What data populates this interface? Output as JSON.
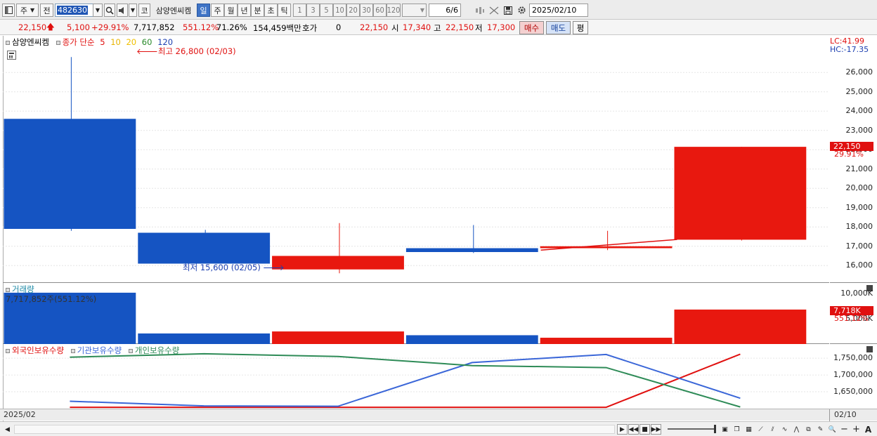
{
  "toolbar": {
    "market_type": "주",
    "prev_label": "전",
    "stock_code": "482630",
    "stock_name": "삼양엔씨켐",
    "periods": [
      "일",
      "주",
      "월",
      "년",
      "분",
      "초",
      "틱"
    ],
    "selected_period": "일",
    "intervals": [
      "1",
      "3",
      "5",
      "10",
      "20",
      "30",
      "60",
      "120"
    ],
    "page": "6/6",
    "date": "2025/02/10",
    "code_prefix": "코"
  },
  "quote": {
    "price": "22,150",
    "change": "5,100",
    "change_pct": "+29.91%",
    "volume": "7,717,852",
    "volume_ratio": "551.12%",
    "turnover_pct": "71.26%",
    "amount": "154,459백만",
    "hoga_label": "호가",
    "hoga_value": "0",
    "hoga_price": "22,150",
    "open_label": "시",
    "open": "17,340",
    "high_label": "고",
    "high": "22,150",
    "low_label": "저",
    "low": "17,300",
    "buy_label": "매수",
    "sell_label": "매도",
    "avg_label": "평"
  },
  "price_pane": {
    "stock_tag": "삼양엔씨켐",
    "legend_prefix": "종가 단순",
    "ma_labels": [
      {
        "label": "5",
        "color": "#e0100f"
      },
      {
        "label": "10",
        "color": "#e8b400"
      },
      {
        "label": "20",
        "color": "#f0c000"
      },
      {
        "label": "60",
        "color": "#2a8a2a"
      },
      {
        "label": "120",
        "color": "#1c3fb0"
      }
    ],
    "high_annotation": "최고 26,800 (02/03)",
    "low_annotation": "최저 15,600 (02/05)",
    "lc_label": "LC:41.99",
    "hc_label": "HC:-17.35",
    "current_price_tag": "22,150",
    "current_pct_tag": "29.91%"
  },
  "volume_pane": {
    "title": "거래량",
    "info": "7,717,852주(551.12%)",
    "current_tag": "7,718K",
    "current_pct_tag": "551.12%"
  },
  "holding_pane": {
    "legend": [
      {
        "label": "외국인보유수량",
        "color": "#e0100f"
      },
      {
        "label": "기관보유수량",
        "color": "#3a66d8"
      },
      {
        "label": "개인보유수량",
        "color": "#2e8b57"
      }
    ]
  },
  "x_axis": {
    "start_label": "2025/02",
    "end_label": "02/10"
  },
  "colors": {
    "up": "#e8180f",
    "down": "#1554c2",
    "bg": "#ffffff"
  },
  "chart_data": [
    {
      "type": "candlestick",
      "title": "",
      "y_ticks": [
        16000,
        17000,
        18000,
        19000,
        20000,
        21000,
        22000,
        23000,
        24000,
        25000,
        26000
      ],
      "y_tick_labels": [
        "16,000",
        "17,000",
        "18,000",
        "19,000",
        "20,000",
        "21,000",
        "22,000",
        "23,000",
        "24,000",
        "25,000",
        "26,000"
      ],
      "ylim": [
        15100,
        27900
      ],
      "candles": [
        {
          "open": 23600,
          "high": 26800,
          "low": 17800,
          "close": 17900
        },
        {
          "open": 17700,
          "high": 17850,
          "low": 16100,
          "close": 16100
        },
        {
          "open": 15800,
          "high": 18200,
          "low": 15600,
          "close": 16500
        },
        {
          "open": 16900,
          "high": 18100,
          "low": 16650,
          "close": 16700
        },
        {
          "open": 16900,
          "high": 17800,
          "low": 16800,
          "close": 17000
        },
        {
          "open": 17340,
          "high": 22150,
          "low": 17300,
          "close": 22150
        }
      ],
      "ma5": [
        null,
        null,
        null,
        null,
        16800,
        17350
      ]
    },
    {
      "type": "bar",
      "title": "",
      "y_ticks": [
        5000,
        10000
      ],
      "y_tick_labels": [
        "5,000K",
        "10,000K"
      ],
      "ylim": [
        0,
        12000
      ],
      "values": [
        10200,
        2100,
        2500,
        1750,
        1250,
        6850
      ],
      "directions": [
        "down",
        "down",
        "up",
        "down",
        "up",
        "up"
      ]
    },
    {
      "type": "line",
      "title": "",
      "y_ticks": [
        1650000,
        1700000,
        1750000
      ],
      "y_tick_labels": [
        "1,650,000",
        "1,700,000",
        "1,750,000"
      ],
      "ylim": [
        1600000,
        1790000
      ],
      "series": [
        {
          "name": "외국인보유수량",
          "color": "#e0100f",
          "values": [
            1604000,
            1604000,
            1604000,
            1604000,
            1604000,
            1762000
          ]
        },
        {
          "name": "기관보유수량",
          "color": "#3a66d8",
          "values": [
            1622000,
            1608000,
            1607000,
            1737000,
            1761000,
            1631000
          ]
        },
        {
          "name": "개인보유수량",
          "color": "#2e8b57",
          "values": [
            1753000,
            1763000,
            1755000,
            1728000,
            1722000,
            1605000
          ]
        }
      ]
    }
  ]
}
